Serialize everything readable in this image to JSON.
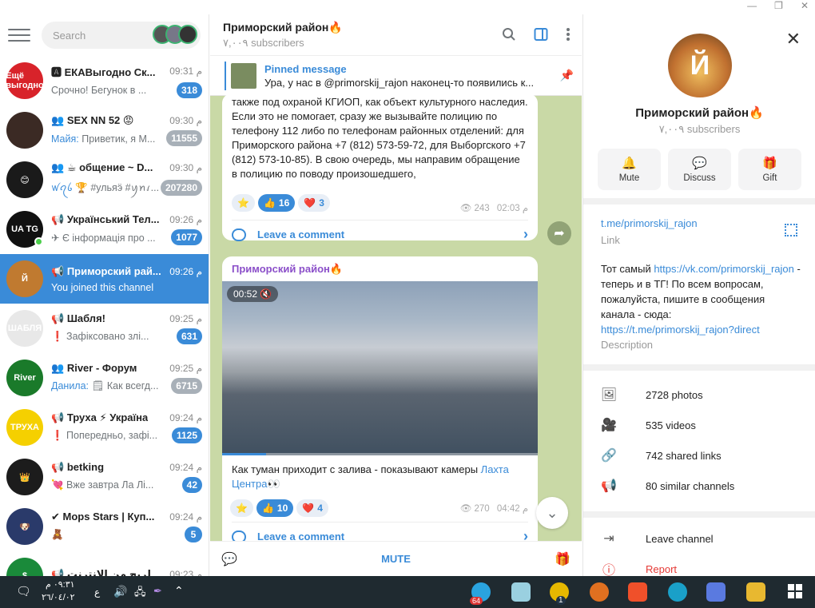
{
  "window": {
    "min": "—",
    "max": "❐",
    "close": "✕"
  },
  "search": {
    "placeholder": "Search"
  },
  "chats": [
    {
      "name": "ЕКАВыгодно Ск...",
      "time": "09:31 م",
      "preview": "Срочно! Бегунок в ...",
      "badge": "318",
      "badge_muted": false,
      "avatar_color": "#d8232a",
      "avatar_text": "Ещё выгодно",
      "prefix_icon": "A+"
    },
    {
      "name": "SEX NN 52 😡",
      "time": "09:30 م",
      "preview_sender": "Майя:",
      "preview": "Приветик, я М...",
      "badge": "11555",
      "badge_muted": true,
      "avatar_color": "#3b2a24",
      "avatar_text": "",
      "prefix_icon": "group"
    },
    {
      "name": "☕ общение ~ D...",
      "time": "09:30 م",
      "preview_sender": "ꪝꪖꪉ 🏆",
      "preview": "#ульяӭ #ꪗꪀꪹ...",
      "badge": "207280",
      "badge_muted": true,
      "avatar_color": "#1a1a1a",
      "avatar_text": "😊",
      "prefix_icon": "group"
    },
    {
      "name": "Український Тел...",
      "time": "09:26 م",
      "preview": "✈ Є інформація про ...",
      "badge": "1077",
      "badge_muted": false,
      "avatar_color": "#111",
      "avatar_text": "UA TG",
      "prefix_icon": "channel",
      "online": true
    },
    {
      "name": "Приморский рай...",
      "time": "09:26 م",
      "preview": "You joined this channel",
      "badge": "",
      "active": true,
      "avatar_color": "#c07a30",
      "avatar_text": "Й",
      "prefix_icon": "channel"
    },
    {
      "name": "Шабля!",
      "time": "09:25 م",
      "preview": "❗ Зафіксовано злі...",
      "badge": "631",
      "badge_muted": false,
      "avatar_color": "#e8e8e8",
      "avatar_text": "ШАБЛЯ",
      "prefix_icon": "channel"
    },
    {
      "name": "River - Форум",
      "time": "09:25 م",
      "preview_sender": "Данила:",
      "preview": "🗒 Как всегд...",
      "badge": "6715",
      "badge_muted": true,
      "avatar_color": "#1a7a2a",
      "avatar_text": "River",
      "prefix_icon": "group"
    },
    {
      "name": "Труха ⚡ Україна",
      "time": "09:24 م",
      "preview": "❗ Попередньо, зафі...",
      "badge": "1125",
      "badge_muted": false,
      "avatar_color": "#f5d000",
      "avatar_text": "ТРУХА",
      "prefix_icon": "channel"
    },
    {
      "name": "betking",
      "time": "09:24 م",
      "preview": "💘 Вже завтра Ла Лі...",
      "badge": "42",
      "badge_muted": false,
      "avatar_color": "#1c1c1c",
      "avatar_text": "👑",
      "prefix_icon": "channel"
    },
    {
      "name": "Mops Stars | Куп...",
      "time": "09:24 م",
      "preview": "🧸",
      "badge": "5",
      "badge_muted": false,
      "avatar_color": "#2a3a6a",
      "avatar_text": "🐶",
      "prefix_icon": "verified"
    },
    {
      "name": "الربح من الانترنت 💸",
      "time": "09:23 م",
      "preview": "",
      "badge": "",
      "avatar_color": "#1a8a3a",
      "avatar_text": "$",
      "prefix_icon": "channel"
    }
  ],
  "channel": {
    "title": "Приморский район🔥",
    "subscribers": "٧,٠٠٩ subscribers"
  },
  "pinned": {
    "title": "Pinned message",
    "text": "Ура, у нас в @primorskij_rajon наконец-то появились к..."
  },
  "msg1": {
    "text": "также под охраной КГИОП, как объект культурного наследия. Если это не помогает, сразу же вызывайте полицию по телефону 112 либо по телефонам районных отделений: для Приморского района  +7 (812) 573-59-72, для Выборгского +7 (812) 573-10-85). В свою очередь, мы направим обращение в полицию по поводу произошедшего,",
    "reactions": [
      {
        "emoji": "⭐",
        "count": ""
      },
      {
        "emoji": "👍",
        "count": "16",
        "on": true
      },
      {
        "emoji": "❤️",
        "count": "3"
      }
    ],
    "views": "243",
    "time": "02:03 م",
    "comment": "Leave a comment"
  },
  "msg2": {
    "author": "Приморский район🔥",
    "video_time": "00:52",
    "text": "Как туман приходит  с залива - показывают камеры ",
    "link": "Лахта Центра",
    "emoji": "👀",
    "reactions": [
      {
        "emoji": "⭐",
        "count": ""
      },
      {
        "emoji": "👍",
        "count": "10",
        "on": true
      },
      {
        "emoji": "❤️",
        "count": "4"
      }
    ],
    "views": "270",
    "time": "04:42 م",
    "comment": "Leave a comment"
  },
  "footer": {
    "mute": "MUTE"
  },
  "info": {
    "name": "Приморский район🔥",
    "subs": "٧,٠٠٩ subscribers",
    "actions": [
      {
        "label": "Mute",
        "icon": "bell-icon",
        "glyph": "🔔"
      },
      {
        "label": "Discuss",
        "icon": "chat-bubble-icon",
        "glyph": "💬"
      },
      {
        "label": "Gift",
        "icon": "gift-icon",
        "glyph": "🎁"
      }
    ],
    "link": "t.me/primorskij_rajon",
    "link_label": "Link",
    "desc_1": "Тот самый ",
    "desc_link1": "https://vk.com/primorskij_rajon",
    "desc_2": " - теперь и в ТГ! По всем вопросам, пожалуйста, пишите в сообщения канала - сюда: ",
    "desc_link2": "https://t.me/primorskij_rajon?direct",
    "desc_label": "Description",
    "media": [
      {
        "label": "2728 photos",
        "icon": "photo-icon",
        "glyph": "🖼"
      },
      {
        "label": "535 videos",
        "icon": "video-icon",
        "glyph": "🎥"
      },
      {
        "label": "742 shared links",
        "icon": "link-icon",
        "glyph": "🔗"
      },
      {
        "label": "80 similar channels",
        "icon": "megaphone-icon",
        "glyph": "📢"
      }
    ],
    "leave": "Leave channel",
    "report": "Report"
  },
  "taskbar": {
    "time": "٠٩:٣١ م",
    "date": "٢٦/٠٤/٠٢",
    "lang": "ع",
    "tg_badge": "64",
    "app_badge": "1"
  }
}
